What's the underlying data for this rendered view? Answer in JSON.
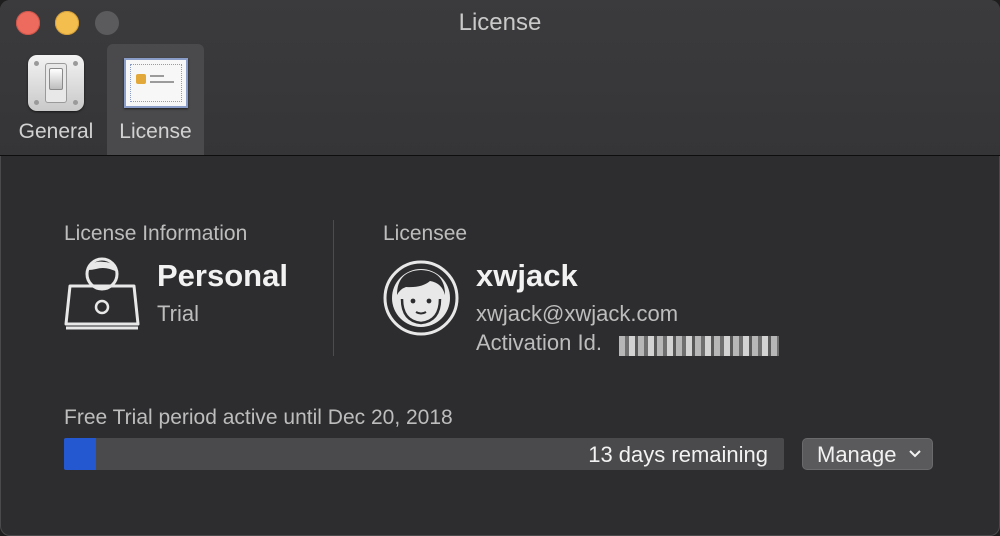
{
  "window": {
    "title": "License"
  },
  "toolbar": {
    "tabs": [
      {
        "label": "General",
        "icon": "switch-icon",
        "selected": false
      },
      {
        "label": "License",
        "icon": "certificate-icon",
        "selected": true
      }
    ]
  },
  "license_info": {
    "heading": "License Information",
    "plan": "Personal",
    "type": "Trial",
    "icon": "user-laptop-icon"
  },
  "licensee": {
    "heading": "Licensee",
    "name": "xwjack",
    "email": "xwjack@xwjack.com",
    "activation_label": "Activation Id.",
    "icon": "avatar-icon"
  },
  "trial": {
    "status_text": "Free Trial period active until Dec 20, 2018",
    "remaining_text": "13 days remaining",
    "progress_fraction": 0.045
  },
  "manage_button": {
    "label": "Manage"
  },
  "colors": {
    "progress_fill": "#2358d1",
    "close": "#ed6a5e",
    "minimize": "#f4be4f",
    "maximize": "#5b5b5d"
  }
}
